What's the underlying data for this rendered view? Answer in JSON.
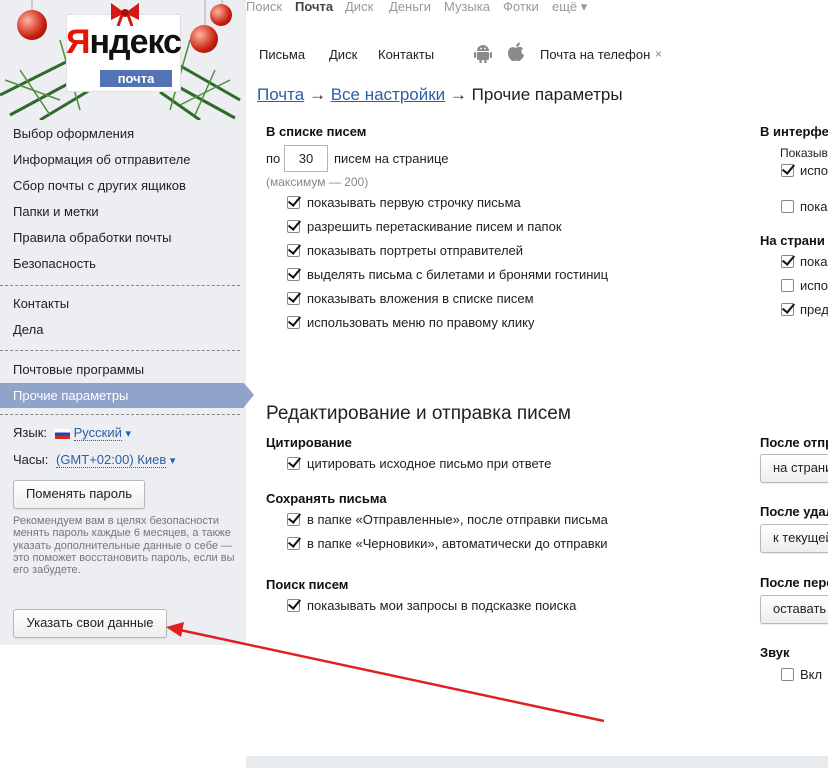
{
  "logo": {
    "title_ya": "Я",
    "title_rest": "ндекс",
    "subtitle": "почта"
  },
  "services": [
    {
      "label": "Поиск",
      "active": false
    },
    {
      "label": "Почта",
      "active": true
    },
    {
      "label": "Диск",
      "active": false
    },
    {
      "label": "Деньги",
      "active": false
    },
    {
      "label": "Музыка",
      "active": false
    },
    {
      "label": "Фотки",
      "active": false
    },
    {
      "label": "ещё ▾",
      "active": false
    }
  ],
  "mail_tabs": {
    "letters": "Письма",
    "disk": "Диск",
    "contacts": "Контакты",
    "phone": "Почта на телефон",
    "phone_close": "×"
  },
  "sidebar": {
    "group1": [
      "Выбор оформления",
      "Информация об отправителе",
      "Сбор почты с других ящиков",
      "Папки и метки",
      "Правила обработки почты",
      "Безопасность"
    ],
    "group2": [
      "Контакты",
      "Дела"
    ],
    "group3": [
      "Почтовые программы",
      "Прочие параметры"
    ],
    "lang_label": "Язык:",
    "lang_value": "Русский",
    "tz_label": "Часы:",
    "tz_value": "(GMT+02:00) Киев",
    "dropdown_arrow": "▾",
    "change_pwd": "Поменять пароль",
    "pwd_note": "Рекомендуем вам в целях безопасности менять пароль каждые 6 месяцев, а также указать дополнительные данные о себе — это поможет восстановить пароль, если вы его забудете.",
    "own_data": "Указать свои данные"
  },
  "breadcrumb": {
    "mail": "Почта",
    "arrow1": "→",
    "all": "Все настройки",
    "arrow2": "→",
    "current": "Прочие параметры"
  },
  "list": {
    "heading": "В списке писем",
    "per_page_prefix": "по",
    "per_page_value": "30",
    "per_page_suffix": "писем на странице",
    "max_note": "(максимум — 200)",
    "options": [
      "показывать первую строчку письма",
      "разрешить перетаскивание писем и папок",
      "показывать портреты отправителей",
      "выделять письма с билетами и бронями гостиниц",
      "показывать вложения в списке писем",
      "использовать меню по правому клику"
    ]
  },
  "editing": {
    "title": "Редактирование и отправка писем",
    "quote_h": "Цитирование",
    "quote_opt": "цитировать исходное письмо при ответе",
    "save_h": "Сохранять письма",
    "save_opt1": "в папке «Отправленные», после отправки письма",
    "save_opt2": "в папке «Черновики», автоматически до отправки",
    "search_h": "Поиск писем",
    "search_opt": "показывать мои запросы в подсказке поиска"
  },
  "right_col": {
    "interface_h": "В интерфе",
    "show_label": "Показыв",
    "use1": "испо",
    "show1": "пока",
    "page_h": "На страни",
    "show2": "пока",
    "use2": "испо",
    "pred": "пред",
    "after_send_h": "После отпр",
    "after_send_btn": "на страни",
    "after_del_h": "После удал",
    "after_del_btn": "к текущей",
    "after_move_h": "После пере",
    "after_move_btn": "оставать",
    "sound_h": "Звук",
    "sound_opt": "Вкл"
  },
  "colors": {
    "link": "#2a5fa8",
    "active_nav": "#90a3c8",
    "arrow": "#e02020"
  }
}
